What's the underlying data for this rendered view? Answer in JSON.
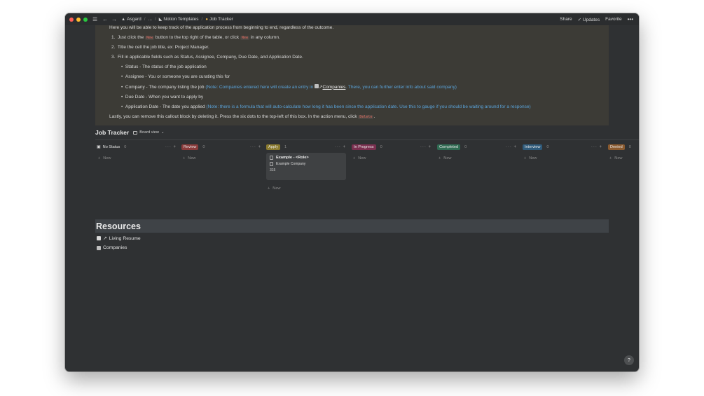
{
  "breadcrumb": {
    "items": [
      "Asgard",
      "...",
      "Notion Templates",
      "Job Tracker"
    ]
  },
  "topbar": {
    "share": "Share",
    "updates": "Updates",
    "favorite": "Favorite",
    "more": "•••"
  },
  "callout": {
    "intro": "Here you will be able to keep track of the application process from beginning to end, regardless of the outcome.",
    "step1_num": "1.",
    "step1_a": "Just click the",
    "step1_code": "New",
    "step1_b": "button to the top right of the table, or click",
    "step1_code2": "New",
    "step1_c": "in any column.",
    "step2_num": "2.",
    "step2": "Title the cell the job title, ex: Project Manager.",
    "step3_num": "3.",
    "step3": "Fill in applicable fields such as Status, Assignee, Company, Due Date, and Application Date.",
    "bullets": {
      "status": "Status - The status of the job application",
      "assignee": "Assignee - You or someone you are curating this for",
      "company_a": "Company - The company listing the job",
      "company_note_a": "(Note: Companies entered here will create an entry in",
      "company_link": "Companies",
      "company_note_b": ". There, you can further enter info about said company)",
      "due": "Due Date - When you want to apply by",
      "appdate_a": "Application Date - The date you applied",
      "appdate_note": "(Note: there is a formula that will auto-calculate how long it has been since the application date. Use this to gauge if you should be waiting around for a response)"
    },
    "lastly_a": "Lastly, you can remove this callout block by deleting it. Press the six dots to the top-left of this box. In the action menu, click",
    "lastly_code": "Delete",
    "lastly_b": "."
  },
  "tracker": {
    "title": "Job Tracker",
    "view": "Board view"
  },
  "columns": [
    {
      "label": "No Status",
      "count": "0",
      "color": "transparent"
    },
    {
      "label": "Review",
      "count": "0",
      "color": "#8a3b3b"
    },
    {
      "label": "Apply",
      "count": "1",
      "color": "#8a7a2e"
    },
    {
      "label": "In Progress",
      "count": "0",
      "color": "#7a2f4f"
    },
    {
      "label": "Completed",
      "count": "0",
      "color": "#2f6b52"
    },
    {
      "label": "Interview",
      "count": "0",
      "color": "#2f5a7a"
    },
    {
      "label": "Denied",
      "count": "0",
      "color": "#8a5a2f"
    }
  ],
  "card": {
    "title": "Example - <Role>",
    "company": "Example Company",
    "number": "315"
  },
  "new_label": "New",
  "resources": {
    "title": "Resources",
    "links": [
      "Living Resume",
      "Companies"
    ]
  },
  "help": "?"
}
